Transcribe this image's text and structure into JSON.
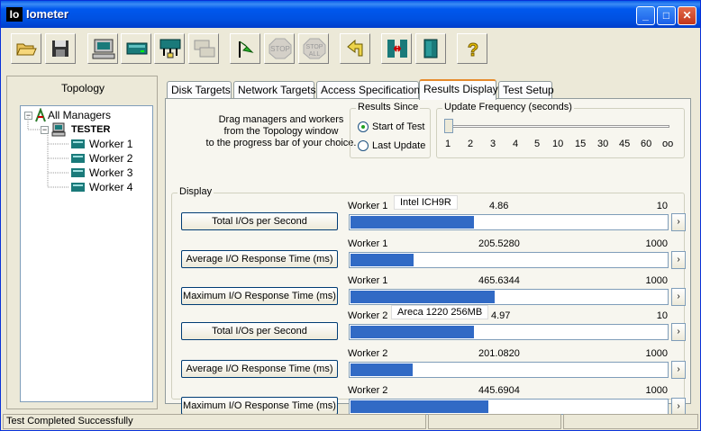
{
  "window": {
    "app_icon": "Io",
    "title": "Iometer",
    "minimize": "_",
    "maximize": "□",
    "close": "✕"
  },
  "toolbar": {
    "icons": [
      "open-folder-icon",
      "save-disk-icon",
      "computer-icon",
      "disk-target-icon",
      "network-target-icon",
      "disk-copy-icon",
      "start-flag-icon",
      "stop-icon",
      "stop-all-icon",
      "reset-arrow-icon",
      "exit-workers-icon",
      "exit-door-icon",
      "help-icon"
    ],
    "stop_text": "STOP",
    "stop_all_text": "STOP",
    "stop_all_sub": "ALL",
    "help_glyph": "?"
  },
  "topology": {
    "title": "Topology",
    "root": "All Managers",
    "manager": "TESTER",
    "workers": [
      "Worker 1",
      "Worker 2",
      "Worker 3",
      "Worker 4"
    ]
  },
  "tabs": [
    "Disk Targets",
    "Network Targets",
    "Access Specifications",
    "Results Display",
    "Test Setup"
  ],
  "active_tab": "Results Display",
  "results": {
    "drag_hint_lines": [
      "Drag managers and workers",
      "from the Topology window",
      "to the progress bar of your choice."
    ],
    "results_since": {
      "label": "Results Since",
      "options": [
        "Start of Test",
        "Last Update"
      ],
      "selected": "Start of Test"
    },
    "update_frequency": {
      "label": "Update Frequency (seconds)",
      "ticks": [
        "1",
        "2",
        "3",
        "4",
        "5",
        "10",
        "15",
        "30",
        "45",
        "60",
        "oo"
      ],
      "value": "1"
    },
    "display_label": "Display",
    "rows": [
      {
        "metric": "Total I/Os per Second",
        "worker": "Worker 1",
        "value": "4.86",
        "max": "10",
        "fill": 0.39,
        "tooltip": "Intel ICH9R"
      },
      {
        "metric": "Average I/O Response Time (ms)",
        "worker": "Worker 1",
        "value": "205.5280",
        "max": "1000",
        "fill": 0.2
      },
      {
        "metric": "Maximum I/O Response Time (ms)",
        "worker": "Worker 1",
        "value": "465.6344",
        "max": "1000",
        "fill": 0.455
      },
      {
        "metric": "Total I/Os per Second",
        "worker": "Worker 2",
        "value": "4.97",
        "max": "10",
        "fill": 0.39,
        "tooltip": "Areca 1220 256MB"
      },
      {
        "metric": "Average I/O Response Time (ms)",
        "worker": "Worker 2",
        "value": "201.0820",
        "max": "1000",
        "fill": 0.197
      },
      {
        "metric": "Maximum I/O Response Time (ms)",
        "worker": "Worker 2",
        "value": "445.6904",
        "max": "1000",
        "fill": 0.435
      }
    ],
    "side_button_glyph": "›"
  },
  "status": {
    "message": "Test Completed Successfully"
  }
}
